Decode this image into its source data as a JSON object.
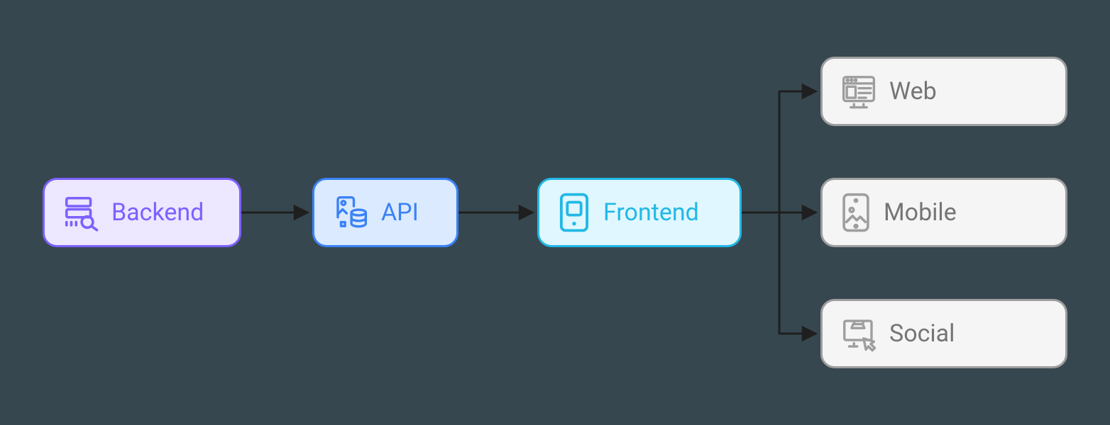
{
  "diagram": {
    "nodes": {
      "backend": {
        "label": "Backend",
        "icon": "server-search-icon",
        "style": "purple"
      },
      "api": {
        "label": "API",
        "icon": "image-db-icon",
        "style": "blue"
      },
      "frontend": {
        "label": "Frontend",
        "icon": "device-icon",
        "style": "cyan"
      },
      "web": {
        "label": "Web",
        "icon": "browser-layout-icon",
        "style": "gray"
      },
      "mobile": {
        "label": "Mobile",
        "icon": "phone-image-icon",
        "style": "gray"
      },
      "social": {
        "label": "Social",
        "icon": "shop-click-icon",
        "style": "gray"
      }
    },
    "edges": [
      {
        "from": "backend",
        "to": "api"
      },
      {
        "from": "api",
        "to": "frontend"
      },
      {
        "from": "frontend",
        "to": "web"
      },
      {
        "from": "frontend",
        "to": "mobile"
      },
      {
        "from": "frontend",
        "to": "social"
      }
    ],
    "colors": {
      "purple_border": "#7b61ff",
      "purple_fill": "#ede7ff",
      "blue_border": "#3b82f6",
      "blue_fill": "#dbeafe",
      "cyan_border": "#22b8e6",
      "cyan_fill": "#e0f7ff",
      "gray_border": "#9e9e9e",
      "gray_fill": "#f5f5f5",
      "gray_text": "#757575",
      "arrow": "#1f1f1f",
      "background": "#37474f"
    }
  }
}
